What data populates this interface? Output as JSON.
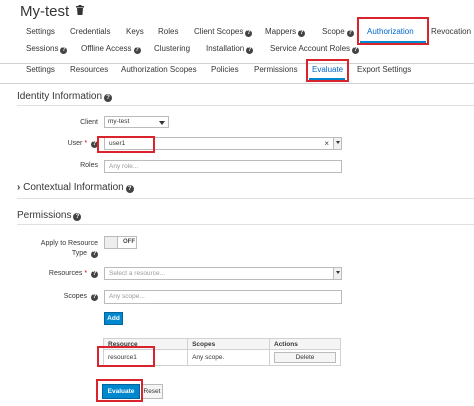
{
  "header": {
    "title": "My-test",
    "trash_icon": "trash-icon"
  },
  "client_tabs": [
    {
      "label": "Settings"
    },
    {
      "label": "Credentials"
    },
    {
      "label": "Keys"
    },
    {
      "label": "Roles"
    },
    {
      "label": "Client Scopes"
    },
    {
      "label": "Mappers"
    },
    {
      "label": "Scope"
    },
    {
      "label": "Authorization"
    },
    {
      "label": "Revocation"
    },
    {
      "label": "Sessions"
    },
    {
      "label": "Offline Access"
    },
    {
      "label": "Clustering"
    },
    {
      "label": "Installation"
    },
    {
      "label": "Service Account Roles"
    }
  ],
  "authz_tabs": [
    {
      "label": "Settings"
    },
    {
      "label": "Resources"
    },
    {
      "label": "Authorization Scopes"
    },
    {
      "label": "Policies"
    },
    {
      "label": "Permissions"
    },
    {
      "label": "Evaluate"
    },
    {
      "label": "Export Settings"
    }
  ],
  "identity": {
    "title": "Identity Information",
    "client_label": "Client",
    "client_value": "my-test",
    "user_label": "User",
    "user_required": "*",
    "user_value": "user1",
    "roles_label": "Roles",
    "roles_placeholder": "Any role..."
  },
  "contextual": {
    "title": "Contextual Information"
  },
  "permissions": {
    "title": "Permissions",
    "apply_label_line1": "Apply to Resource",
    "apply_label_line2": "Type",
    "toggle_state": "OFF",
    "resources_label": "Resources",
    "resources_required": "*",
    "resources_placeholder": "Select a resource...",
    "scopes_label": "Scopes",
    "scopes_placeholder": "Any scope...",
    "add_label": "Add",
    "columns": [
      "Resource",
      "Scopes",
      "Actions"
    ],
    "rows": [
      {
        "resource": "resource1",
        "scopes": "Any scope.",
        "action": "Delete"
      }
    ]
  },
  "footer": {
    "evaluate_label": "Evaluate",
    "reset_label": "Reset"
  },
  "colors": {
    "accent": "#0088ce",
    "highlight_box": "#d9232d"
  }
}
